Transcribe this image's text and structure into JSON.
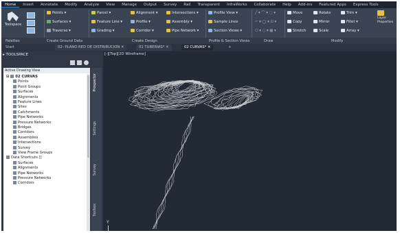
{
  "menu": {
    "tabs": [
      "Home",
      "Insert",
      "Annotate",
      "Modify",
      "Analyze",
      "View",
      "Manage",
      "Output",
      "Survey",
      "Rail",
      "Transparent",
      "InfraWorks",
      "Collaborate",
      "Help",
      "Add-ins",
      "Featured Apps",
      "Express Tools"
    ]
  },
  "ribbon": {
    "toolspace_label": "Toolspace",
    "buttons": {
      "points": "Points",
      "surfaces": "Surfaces",
      "traverse": "Traverse",
      "parcel": "Parcel",
      "feature_line": "Feature Line",
      "grading": "Grading",
      "alignment": "Alignment",
      "profile": "Profile",
      "corridor": "Corridor",
      "intersections": "Intersections",
      "assembly": "Assembly",
      "pipe_network": "Pipe Network",
      "profile_view": "Profile View",
      "sample_lines": "Sample Lines",
      "section_views": "Section Views",
      "move": "Move",
      "rotate": "Rotate",
      "trim": "Trim",
      "copy": "Copy",
      "mirror": "Mirror",
      "fillet": "Fillet",
      "stretch": "Stretch",
      "scale": "Scale",
      "array": "Array",
      "layer_props": "Layer Properties"
    },
    "panels": [
      "Palettes",
      "Create Ground Data",
      "Create Design",
      "Profile & Section Views",
      "Draw",
      "Modify"
    ]
  },
  "doctabs": {
    "start": "Start",
    "tabs": [
      "02- PLANO RED DE DISTRIBUCION",
      "01 TUBERIAS*",
      "02 CURVAS*"
    ],
    "active_index": 2,
    "add": "+"
  },
  "toolspace": {
    "title": "TOOLSPACE",
    "view": "Active Drawing View",
    "tree": [
      {
        "label": "02 CURVAS",
        "level": 0,
        "bold": true,
        "expander": "-"
      },
      {
        "label": "Points",
        "level": 1
      },
      {
        "label": "Point Groups",
        "level": 1
      },
      {
        "label": "Surfaces",
        "level": 1
      },
      {
        "label": "Alignments",
        "level": 1
      },
      {
        "label": "Feature Lines",
        "level": 1
      },
      {
        "label": "Sites",
        "level": 1
      },
      {
        "label": "Catchments",
        "level": 1
      },
      {
        "label": "Pipe Networks",
        "level": 1
      },
      {
        "label": "Pressure Networks",
        "level": 1
      },
      {
        "label": "Bridges",
        "level": 1
      },
      {
        "label": "Corridors",
        "level": 1
      },
      {
        "label": "Assemblies",
        "level": 1
      },
      {
        "label": "Intersections",
        "level": 1
      },
      {
        "label": "Survey",
        "level": 1
      },
      {
        "label": "View Frame Groups",
        "level": 1
      },
      {
        "label": "Data Shortcuts []",
        "level": 0
      },
      {
        "label": "Surfaces",
        "level": 1
      },
      {
        "label": "Alignments",
        "level": 1
      },
      {
        "label": "Pipe Networks",
        "level": 1
      },
      {
        "label": "Pressure Networks",
        "level": 1
      },
      {
        "label": "Corridors",
        "level": 1
      }
    ],
    "side_tabs": [
      "Prospector",
      "Settings",
      "Survey",
      "Toolbox"
    ]
  },
  "viewport": {
    "label": "[-][Top][2D Wireframe]",
    "ucs_y": "Y"
  },
  "colors": {
    "menubar": "#1d2430",
    "ribbon": "#3b4453",
    "viewport": "#222a35",
    "accent": "#3c8ed9"
  }
}
